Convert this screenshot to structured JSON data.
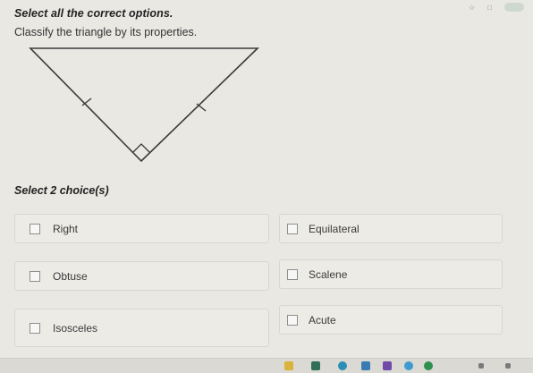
{
  "question": {
    "title": "Select all the correct options.",
    "prompt": "Classify the triangle by its properties."
  },
  "instructions": {
    "select_count": "Select 2 choice(s)"
  },
  "choices": [
    {
      "label": "Right",
      "checked": false
    },
    {
      "label": "Equilateral",
      "checked": false
    },
    {
      "label": "Obtuse",
      "checked": false
    },
    {
      "label": "Scalene",
      "checked": false
    },
    {
      "label": "Isosceles",
      "checked": false
    },
    {
      "label": "Acute",
      "checked": false
    }
  ],
  "colors": {
    "background": "#e9e8e3",
    "triangle_stroke": "#3a3a3a",
    "choice_border": "#d7d6d0"
  },
  "icons": [
    "tick-mark-icon",
    "angle-mark-icon",
    "checkbox-icon",
    "taskbar-app-icons"
  ]
}
